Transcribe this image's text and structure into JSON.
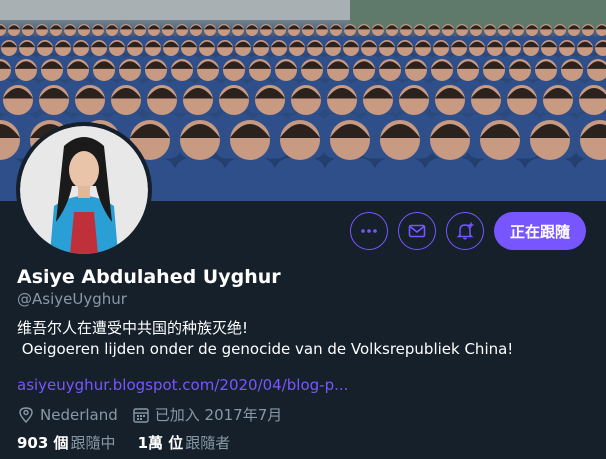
{
  "profile": {
    "name": "Asiye Abdulahed Uyghur",
    "handle": "@AsiyeUyghur",
    "bio_line1": "维吾尔人在遭受中共国的种族灭绝!",
    "bio_line2": " Oeigoeren lijden onder de genocide van de Volksrepubliek China!",
    "website": "asiyeuyghur.blogspot.com/2020/04/blog-p...",
    "location": "Nederland",
    "joined": "已加入 2017年7月",
    "following_count": "903 個",
    "following_label": "跟隨中",
    "followers_count": "1萬 位",
    "followers_label": "跟隨者"
  },
  "actions": {
    "follow_label": "正在跟隨"
  },
  "icons": {
    "more": "more-icon",
    "message": "mail-icon",
    "notify": "bell-plus-icon",
    "location": "location-pin-icon",
    "calendar": "calendar-icon"
  },
  "colors": {
    "background": "#15202b",
    "accent": "#7856ff",
    "secondary_text": "#8899a6",
    "primary_text": "#ffffff"
  }
}
